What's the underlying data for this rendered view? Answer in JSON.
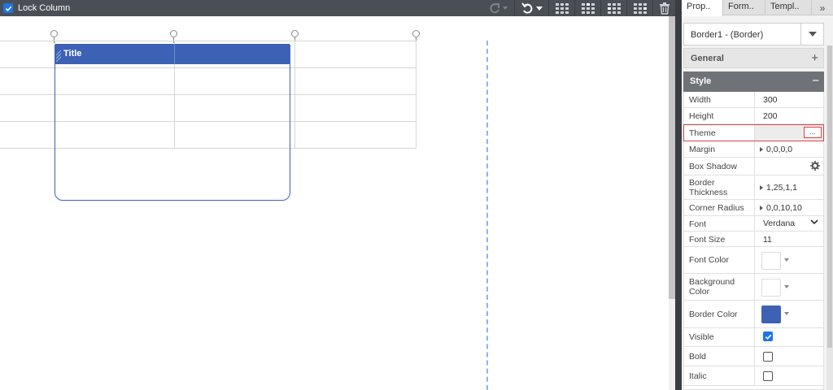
{
  "toolbar": {
    "lock_column_label": "Lock Column",
    "lock_column_checked": true
  },
  "canvas": {
    "title_text": "Title"
  },
  "panel": {
    "tabs": [
      {
        "label": "Prop.."
      },
      {
        "label": "Form.."
      },
      {
        "label": "Templ.."
      }
    ],
    "more_tabs_symbol": "»",
    "selector_value": "Border1 - (Border)",
    "general_label": "General",
    "general_symbol": "+",
    "style_label": "Style",
    "style_symbol": "−",
    "props": {
      "width": {
        "label": "Width",
        "value": "300"
      },
      "height": {
        "label": "Height",
        "value": "200"
      },
      "theme": {
        "label": "Theme",
        "button": "..."
      },
      "margin": {
        "label": "Margin",
        "value": "0,0,0,0"
      },
      "box_shadow": {
        "label": "Box Shadow"
      },
      "border_thickness": {
        "label": "Border Thickness",
        "value": "1,25,1,1"
      },
      "corner_radius": {
        "label": "Corner Radius",
        "value": "0,0,10,10"
      },
      "font": {
        "label": "Font",
        "value": "Verdana"
      },
      "font_size": {
        "label": "Font Size",
        "value": "11"
      },
      "font_color": {
        "label": "Font Color",
        "color": "#ffffff"
      },
      "background_color": {
        "label": "Background Color",
        "color": "#ffffff"
      },
      "border_color": {
        "label": "Border Color",
        "color": "#3d62b5"
      },
      "visible": {
        "label": "Visible",
        "checked": true
      },
      "bold": {
        "label": "Bold",
        "checked": false
      },
      "italic": {
        "label": "Italic",
        "checked": false
      }
    }
  },
  "colors": {
    "accent": "#3d62b5",
    "toolbar_bg": "#4a4f55",
    "checkbox_blue": "#1e73e8",
    "highlight_red": "#d94545"
  }
}
